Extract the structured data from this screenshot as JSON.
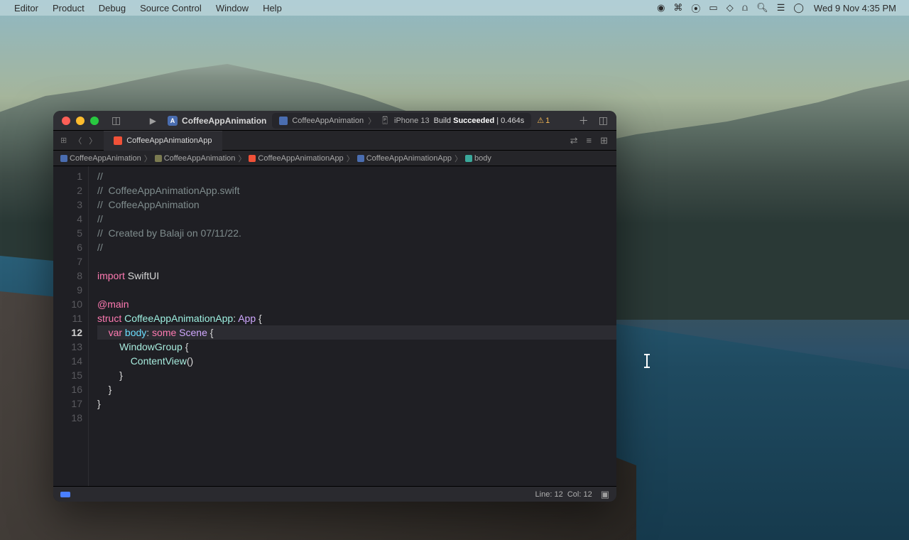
{
  "menubar": {
    "items": [
      "Editor",
      "Product",
      "Debug",
      "Source Control",
      "Window",
      "Help"
    ],
    "datetime": "Wed 9 Nov 4:35 PM"
  },
  "toolbar": {
    "project_name": "CoffeeAppAnimation",
    "activity_project": "CoffeeAppAnimation",
    "device": "iPhone 13",
    "build_prefix": "Build ",
    "build_status": "Succeeded",
    "build_time": " | 0.464s",
    "warnings": "1"
  },
  "tab": {
    "label": "CoffeeAppAnimationApp"
  },
  "jumpbar": {
    "segments": [
      "CoffeeAppAnimation",
      "CoffeeAppAnimation",
      "CoffeeAppAnimationApp",
      "CoffeeAppAnimationApp",
      "body"
    ]
  },
  "code": {
    "lines": [
      {
        "n": "1",
        "html": "<span class='c-comment'>//</span>"
      },
      {
        "n": "2",
        "html": "<span class='c-comment'>//  CoffeeAppAnimationApp.swift</span>"
      },
      {
        "n": "3",
        "html": "<span class='c-comment'>//  CoffeeAppAnimation</span>"
      },
      {
        "n": "4",
        "html": "<span class='c-comment'>//</span>"
      },
      {
        "n": "5",
        "html": "<span class='c-comment'>//  Created by Balaji on 07/11/22.</span>"
      },
      {
        "n": "6",
        "html": "<span class='c-comment'>//</span>"
      },
      {
        "n": "7",
        "html": ""
      },
      {
        "n": "8",
        "html": "<span class='c-keyword'>import</span> <span class='c-name'>SwiftUI</span>"
      },
      {
        "n": "9",
        "html": ""
      },
      {
        "n": "10",
        "html": "<span class='c-attr'>@main</span>"
      },
      {
        "n": "11",
        "html": "<span class='c-keyword'>struct</span> <span class='c-type'>CoffeeAppAnimationApp</span><span class='c-name'>: </span><span class='c-stdtype'>App</span><span class='c-name'> {</span>"
      },
      {
        "n": "12",
        "current": true,
        "html": "    <span class='c-keyword'>var</span> <span class='c-ident'>body</span><span class='c-name'>: </span><span class='c-keyword'>some</span> <span class='c-stdtype'>Scene</span><span class='c-name'> {</span>"
      },
      {
        "n": "13",
        "html": "        <span class='c-func'>WindowGroup</span><span class='c-name'> {</span>"
      },
      {
        "n": "14",
        "html": "            <span class='c-func'>ContentView</span><span class='c-name'>()</span>"
      },
      {
        "n": "15",
        "html": "        <span class='c-name'>}</span>"
      },
      {
        "n": "16",
        "html": "    <span class='c-name'>}</span>"
      },
      {
        "n": "17",
        "html": "<span class='c-name'>}</span>"
      },
      {
        "n": "18",
        "html": ""
      }
    ]
  },
  "statusbar": {
    "line_label": "Line:",
    "line_val": "12",
    "col_label": "Col:",
    "col_val": "12"
  }
}
